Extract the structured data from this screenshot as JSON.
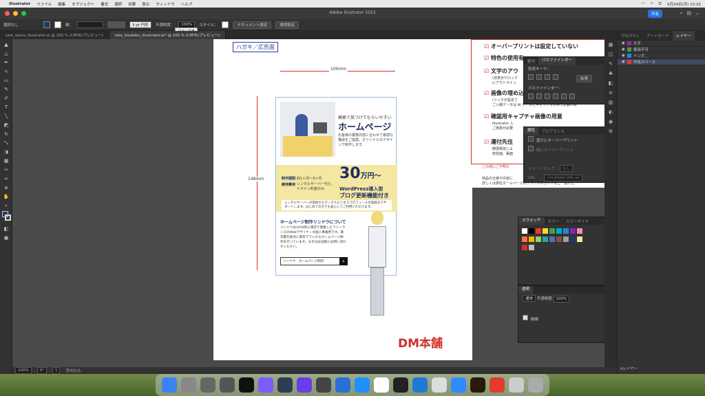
{
  "menubar": {
    "app": "Illustrator",
    "items": [
      "ファイル",
      "編集",
      "オブジェクト",
      "書式",
      "選択",
      "効果",
      "表示",
      "ウィンドウ",
      "ヘルプ"
    ],
    "clock": "5月24日(月)  13:32"
  },
  "window": {
    "title": "Adobe Illustrator 2023",
    "share": "共有"
  },
  "control": {
    "selection": "選択なし",
    "stroke_label": "線：",
    "brush": "3 pt 円形",
    "brush_tip": "ブラシ定義",
    "opacity_label": "不透明度：",
    "opacity": "100%",
    "style_label": "スタイル：",
    "doc_settings": "ドキュメント設定",
    "prefs": "環境設定"
  },
  "tabs": [
    "tate_stena_illustrator.ai @ 100 % (CMYK/プレビュー)",
    "tate_koukoku_illustrator.ai* @ 100 % (CMYK/プレビュー)"
  ],
  "status": {
    "zoom": "100%",
    "angle": "0°",
    "page": "1",
    "tool": "手のひら"
  },
  "doc": {
    "tag": "ハガキ／広告面",
    "dim_w": "100mm",
    "dim_h": "148mm",
    "headline_small": "検索で見つけてもらいやすい",
    "headline": "ホームページ",
    "desc": "お客様の業務内容に合わせて最適な構成をご提案。オリジナルのデザインで制作します。",
    "period_label": "制作期間",
    "period": "約1ヶ月〜3ヶ月",
    "cost_label": "維持費用",
    "cost": "レンタルサーバー代と、ドメイン料金のみ",
    "price": "30",
    "price_unit": "万円〜",
    "wp1": "WordPress導入型",
    "wp2": "ブログ更新機能付き",
    "note": "レンタルサーバーの契約からグーグルビジネスプロフィールの登録までサポートします。はじめての方でも安心してご利用いただけます。",
    "about_title": "ホームページ制作リンドウについて",
    "about": "リンドウは2018年に東京で開業したフリーランスのWebデザイナーの個人事業所です。東京都を拠点に東京でていけるホームページ制作を行っています。まずはお気軽にお問い合わせください。",
    "search": "リンドウ　ホームページ制作",
    "logo": "DM本舗"
  },
  "checklist": [
    "オーバープリントは設定していない",
    "特色の使用有",
    "文字のアウ",
    "画像の埋め込",
    "確認用キャプチャ画像の用意",
    "運付先住"
  ],
  "checklist_notes": [
    "(非表示やロック",
    "にアウトライン",
    "(リンクが設定さ",
    "ご入稿データは AI データとキャプチャのみでお願い致",
    "Illustrator 入",
    "ご用意が必要",
    "郵便規定によ",
    "宛名面、裏面"
  ],
  "side_text": [
    "商品の仕様や内容に",
    "詳しくは弊社ホームページのテクニカルガイドをご一読くだ"
  ],
  "red_note": "この他にご不明な",
  "pathfinder": {
    "tabs": [
      "整列",
      "パスファインダー"
    ],
    "shape_mode": "形状モード：",
    "pathfinder_label": "パスファインダー：",
    "expand": "拡張"
  },
  "attributes": {
    "tabs": [
      "属性",
      "アピアランス"
    ],
    "fill_overprint": "塗りにオーバープリント",
    "stroke_overprint": "線にオーバープリント",
    "imagemap": "イメージマップ",
    "imagemap_val": "なし",
    "url": "URL",
    "url_val": "<multiple URL ex"
  },
  "swatches": {
    "tabs": [
      "スウォッチ",
      "カラー",
      "カラーガイド"
    ]
  },
  "transparency": {
    "title": "透明",
    "mode": "通常",
    "opacity_label": "不透明度",
    "opacity": "100%",
    "opacity_mask": "破線"
  },
  "rightpanel": {
    "tabs": [
      "プロパティ",
      "アートボード",
      "レイヤー"
    ],
    "layers": [
      "文字",
      "使用不可",
      "トンボ＿",
      "作成スペース"
    ],
    "footer": "4レイヤー"
  },
  "colors": {
    "accent": "#2d6fe0",
    "yellow": "#f3e7a1",
    "red": "#d0302c",
    "check": "#c0262a"
  }
}
